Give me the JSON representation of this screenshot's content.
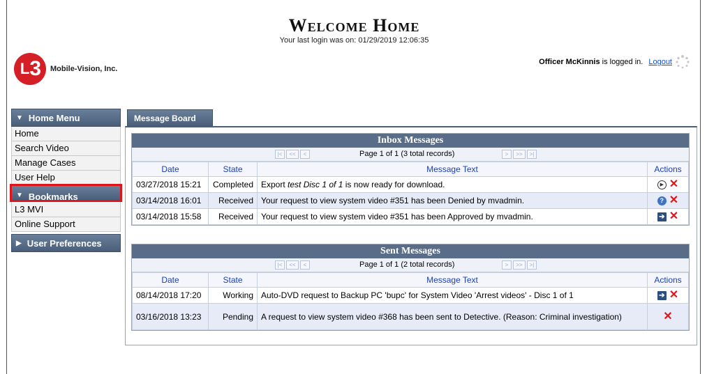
{
  "header": {
    "company": "Mobile-Vision, Inc.",
    "logo_text": "L",
    "logo_num": "3",
    "title": "Welcome Home",
    "last_login": "Your last login was on: 01/29/2019 12:06:35",
    "user_name": "Officer McKinnis",
    "logged_in_suffix": "is logged in.",
    "logout_label": "Logout"
  },
  "sidebar": {
    "home_menu": {
      "label": "Home Menu",
      "items": [
        "Home",
        "Search Video",
        "Manage Cases",
        "User Help"
      ]
    },
    "bookmarks": {
      "label": "Bookmarks",
      "items": [
        "L3 MVI",
        "Online Support"
      ]
    },
    "user_prefs": {
      "label": "User Preferences"
    }
  },
  "tab": {
    "label": "Message Board"
  },
  "inbox": {
    "title": "Inbox Messages",
    "pager": "Page 1 of 1 (3 total records)",
    "columns": [
      "Date",
      "State",
      "Message Text",
      "Actions"
    ],
    "rows": [
      {
        "date": "03/27/2018 15:21",
        "state": "Completed",
        "text_pre": "Export ",
        "text_em": "test Disc 1 of 1",
        "text_post": " is now ready for download.",
        "action": "play"
      },
      {
        "date": "03/14/2018 16:01",
        "state": "Received",
        "text_pre": "Your request to view system video #351 has been Denied by mvadmin.",
        "text_em": "",
        "text_post": "",
        "action": "help"
      },
      {
        "date": "03/14/2018 15:58",
        "state": "Received",
        "text_pre": "Your request to view system video #351 has been Approved by mvadmin.",
        "text_em": "",
        "text_post": "",
        "action": "go"
      }
    ]
  },
  "sent": {
    "title": "Sent Messages",
    "pager": "Page 1 of 1 (2 total records)",
    "columns": [
      "Date",
      "State",
      "Message Text",
      "Actions"
    ],
    "rows": [
      {
        "date": "08/14/2018 17:20",
        "state": "Working",
        "text": "Auto-DVD request to Backup PC 'bupc' for System Video 'Arrest videos' - Disc 1 of 1",
        "action": "go"
      },
      {
        "date": "03/16/2018 13:23",
        "state": "Pending",
        "text": "A request to view system video #368 has been sent to Detective. (Reason: Criminal investigation)",
        "action": "none"
      }
    ]
  },
  "colors": {
    "accent": "#4a5e7a",
    "highlight": "#e0151b",
    "link": "#1a4fd0"
  }
}
